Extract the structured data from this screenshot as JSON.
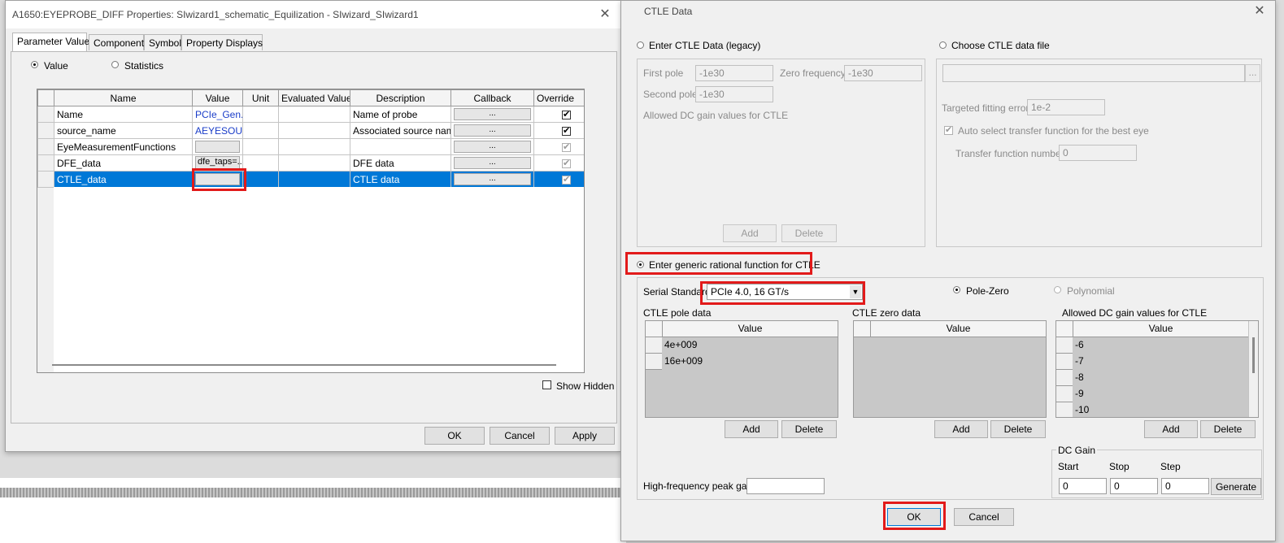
{
  "left_dialog": {
    "title": "A1650:EYEPROBE_DIFF Properties: SIwizard1_schematic_Equilization - SIwizard_SIwizard1",
    "close_glyph": "✕",
    "tabs": [
      "Parameter Values",
      "Component",
      "Symbol",
      "Property Displays"
    ],
    "mode_value": "Value",
    "mode_statistics": "Statistics",
    "columns": [
      "Name",
      "Value",
      "Unit",
      "Evaluated Value",
      "Description",
      "Callback",
      "Override"
    ],
    "rows": [
      {
        "name": "Name",
        "value": "PCIe_Gen...",
        "description": "Name of probe",
        "callback": "...",
        "override": true
      },
      {
        "name": "source_name",
        "value": "AEYESOU...",
        "description": "Associated source name",
        "callback": "...",
        "override": true
      },
      {
        "name": "EyeMeasurementFunctions",
        "value": "",
        "description": "",
        "callback": "...",
        "override": true
      },
      {
        "name": "DFE_data",
        "value": "dfe_taps=...",
        "description": "DFE data",
        "callback": "...",
        "override": true
      },
      {
        "name": "CTLE_data",
        "value": "",
        "description": "CTLE data",
        "callback": "...",
        "override": true
      }
    ],
    "show_hidden_label": "Show Hidden",
    "ok_label": "OK",
    "cancel_label": "Cancel",
    "apply_label": "Apply"
  },
  "ctle_dialog": {
    "title": "CTLE Data",
    "close_glyph": "✕",
    "legacy_radio_label": "Enter CTLE Data (legacy)",
    "first_pole_label": "First pole",
    "first_pole_value": "-1e30",
    "zero_frequency_label": "Zero frequency",
    "zero_frequency_value": "-1e30",
    "second_pole_label": "Second pole",
    "second_pole_value": "-1e30",
    "allowed_dc_legacy_label": "Allowed DC gain values for CTLE",
    "legacy_add": "Add",
    "legacy_delete": "Delete",
    "file_radio_label": "Choose CTLE data file",
    "browse_label": "...",
    "fitting_error_label": "Targeted fitting error",
    "fitting_error_value": "1e-2",
    "auto_select_label": "Auto select transfer function for the best eye",
    "tf_number_label": "Transfer function number",
    "tf_number_value": "0",
    "generic_radio_label": "Enter generic rational function for CTLE",
    "serial_standard_label": "Serial Standard",
    "serial_standard_value": "PCIe 4.0, 16 GT/s",
    "pole_zero_label": "Pole-Zero",
    "polynomial_label": "Polynomial",
    "pole_data_label": "CTLE pole data",
    "zero_data_label": "CTLE zero data",
    "allowed_dc_label": "Allowed DC gain values for CTLE",
    "value_header": "Value",
    "pole_values": [
      "4e+009",
      "16e+009"
    ],
    "zero_values": [],
    "dc_gain_values": [
      "-6",
      "-7",
      "-8",
      "-9",
      "-10"
    ],
    "add_label": "Add",
    "delete_label": "Delete",
    "hf_peak_gain_label": "High-frequency peak gain",
    "hf_peak_gain_value": "",
    "dc_gain_group_label": "DC Gain",
    "start_label": "Start",
    "stop_label": "Stop",
    "step_label": "Step",
    "start_value": "0",
    "stop_value": "0",
    "step_value": "0",
    "generate_label": "Generate",
    "ok_label": "OK",
    "cancel_label": "Cancel"
  },
  "colors": {
    "selection": "#0078d7",
    "highlight_box": "#e21a1a",
    "link_value": "#1a3dc8"
  }
}
